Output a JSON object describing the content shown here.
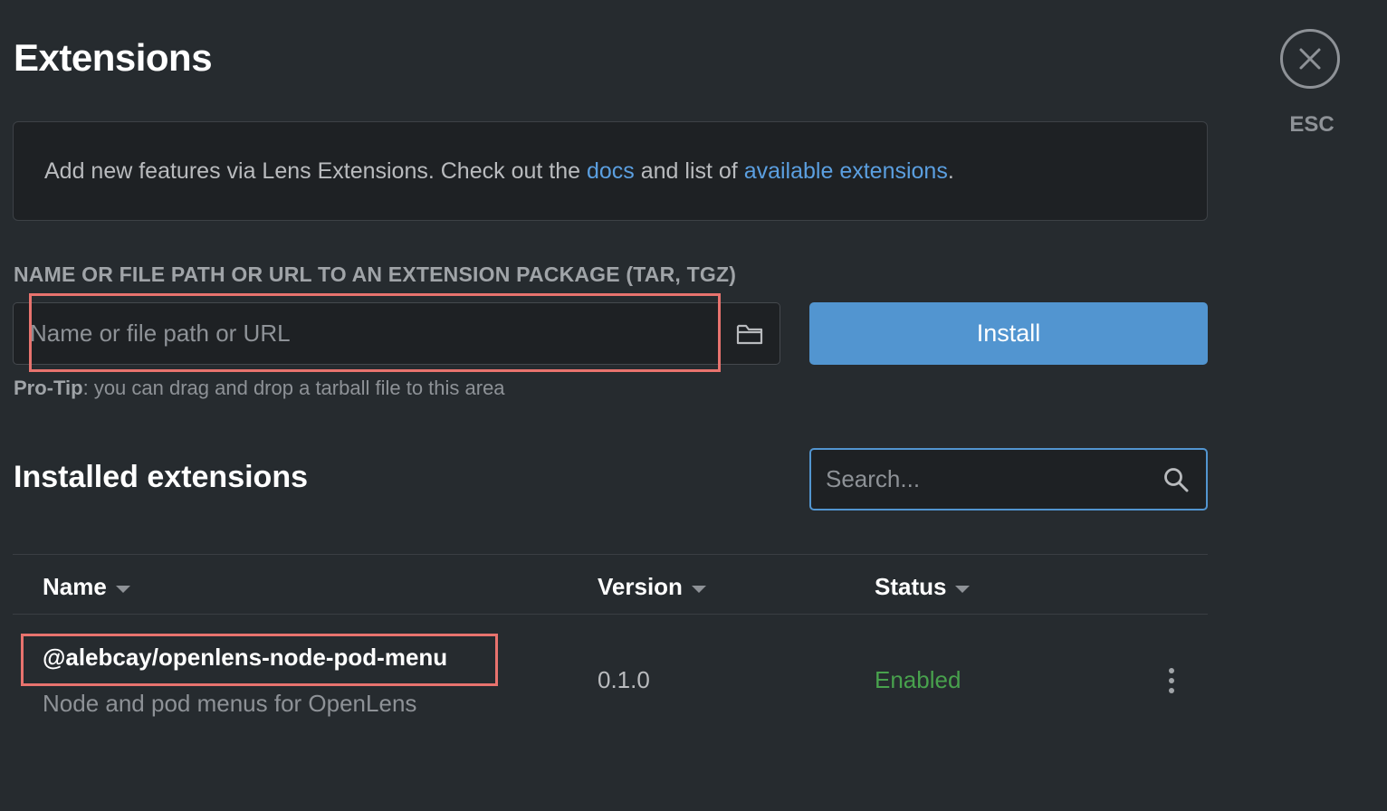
{
  "page": {
    "title": "Extensions",
    "close_label": "ESC"
  },
  "info": {
    "text_before": "Add new features via Lens Extensions. Check out the ",
    "docs_link": "docs",
    "text_middle": " and list of ",
    "available_link": "available extensions",
    "text_after": "."
  },
  "install": {
    "field_label": "NAME OR FILE PATH OR URL TO AN EXTENSION PACKAGE (TAR, TGZ)",
    "input_value": "",
    "input_placeholder": "Name or file path or URL",
    "button_label": "Install",
    "protip_bold": "Pro-Tip",
    "protip_text": ": you can drag and drop a tarball file to this area"
  },
  "installed": {
    "title": "Installed extensions",
    "search_placeholder": "Search...",
    "columns": {
      "name": "Name",
      "version": "Version",
      "status": "Status"
    },
    "rows": [
      {
        "name": "@alebcay/openlens-node-pod-menu",
        "description": "Node and pod menus for OpenLens",
        "version": "0.1.0",
        "status": "Enabled"
      }
    ]
  },
  "colors": {
    "accent": "#5295d0",
    "link": "#5b9fe0",
    "status_enabled": "#48a14d",
    "highlight": "#e8736e",
    "background": "#262b2f"
  },
  "icons": {
    "close": "close-icon",
    "folder": "folder-icon",
    "search": "search-icon",
    "more": "more-vertical-icon",
    "sort": "caret-down-icon"
  }
}
